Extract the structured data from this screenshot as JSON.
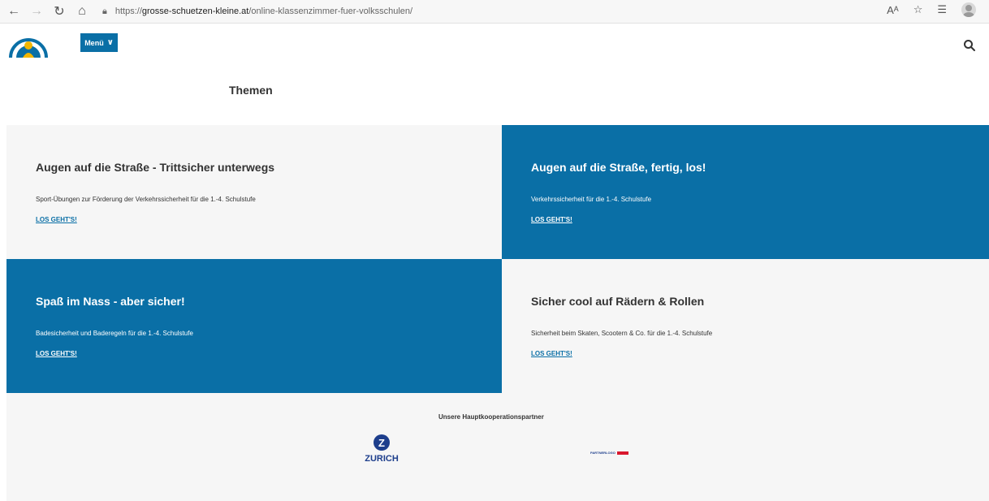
{
  "browser": {
    "url_prefix": "https://",
    "url_host": "grosse-schuetzen-kleine.at",
    "url_path": "/online-klassenzimmer-fuer-volksschulen/",
    "reader_icon_label": "Aᴬ"
  },
  "header": {
    "menu_label": "Menü",
    "menu_chevron": "∨"
  },
  "section_title": "Themen",
  "tiles": [
    {
      "title": "Augen auf die Straße - Trittsicher unterwegs",
      "description": "Sport-Übungen zur Förderung der Verkehrssicherheit für die 1.-4. Schulstufe",
      "link": "LOS GEHT'S!"
    },
    {
      "title": "Augen auf die Straße, fertig, los!",
      "description": "Verkehrssicherheit für die 1.-4. Schulstufe",
      "link": "LOS GEHT'S!"
    },
    {
      "title": "Spaß im Nass - aber sicher!",
      "description": "Badesicherheit und Baderegeln für die 1.-4. Schulstufe",
      "link": "LOS GEHT'S!"
    },
    {
      "title": "Sicher cool auf Rädern & Rollen",
      "description": "Sicherheit beim Skaten, Scootern & Co. für die 1.-4. Schulstufe",
      "link": "LOS GEHT'S!"
    }
  ],
  "partners": {
    "title": "Unsere Hauptkooperationspartner",
    "zurich_badge": "Z",
    "zurich_name": "ZURICH",
    "partner2_text": "PARTNERLOGO"
  },
  "colors": {
    "brand_blue": "#0a6fa6",
    "tile_light": "#f6f6f6",
    "zurich_blue": "#1d3e8c"
  }
}
